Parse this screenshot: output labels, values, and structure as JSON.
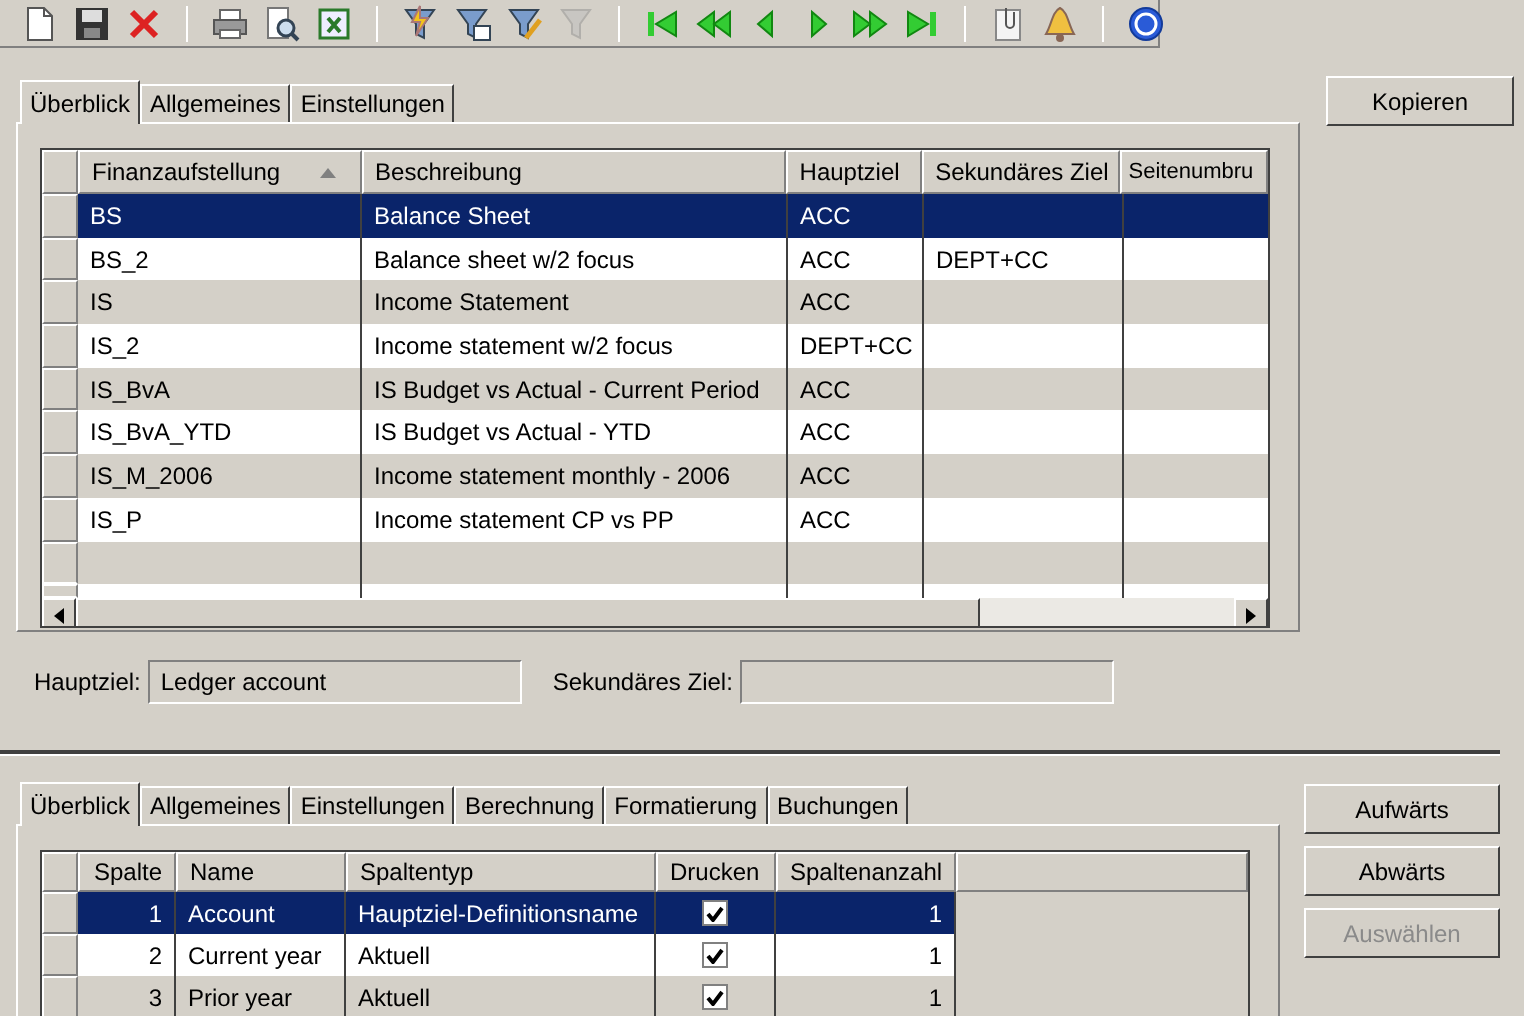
{
  "toolbar": [
    {
      "kind": "new",
      "disabled": false
    },
    {
      "kind": "save",
      "disabled": false
    },
    {
      "kind": "delete",
      "disabled": false
    },
    {
      "kind": "sep"
    },
    {
      "kind": "print",
      "disabled": false
    },
    {
      "kind": "preview",
      "disabled": false
    },
    {
      "kind": "excel",
      "disabled": false
    },
    {
      "kind": "sep"
    },
    {
      "kind": "filter-bolt",
      "disabled": false
    },
    {
      "kind": "filter-table",
      "disabled": false
    },
    {
      "kind": "filter-pencil",
      "disabled": false
    },
    {
      "kind": "filter-clear",
      "disabled": true
    },
    {
      "kind": "sep"
    },
    {
      "kind": "first",
      "disabled": false
    },
    {
      "kind": "prev-page",
      "disabled": false
    },
    {
      "kind": "prev",
      "disabled": false
    },
    {
      "kind": "next",
      "disabled": false
    },
    {
      "kind": "next-page",
      "disabled": false
    },
    {
      "kind": "last",
      "disabled": false
    },
    {
      "kind": "sep"
    },
    {
      "kind": "attach",
      "disabled": false
    },
    {
      "kind": "alert",
      "disabled": false
    },
    {
      "kind": "sep"
    },
    {
      "kind": "help",
      "disabled": false
    }
  ],
  "upper": {
    "tabs": [
      {
        "label": "Überblick",
        "selected": true
      },
      {
        "label": "Allgemeines",
        "selected": false
      },
      {
        "label": "Einstellungen",
        "selected": false
      }
    ],
    "table": {
      "columns": [
        {
          "label": "Finanzaufstellung",
          "sorted_ascending": true
        },
        {
          "label": "Beschreibung"
        },
        {
          "label": "Hauptziel"
        },
        {
          "label": "Sekundäres Ziel"
        },
        {
          "label": "Seitenumbru"
        }
      ],
      "rows": [
        {
          "cells": [
            "BS",
            "Balance Sheet",
            "ACC",
            "",
            ""
          ],
          "selected": true
        },
        {
          "cells": [
            "BS_2",
            "Balance sheet w/2 focus",
            "ACC",
            "DEPT+CC",
            ""
          ],
          "selected": false
        },
        {
          "cells": [
            "IS",
            "Income Statement",
            "ACC",
            "",
            ""
          ],
          "selected": false
        },
        {
          "cells": [
            "IS_2",
            "Income statement w/2 focus",
            "DEPT+CC",
            "",
            ""
          ],
          "selected": false
        },
        {
          "cells": [
            "IS_BvA",
            "IS Budget vs Actual - Current Period",
            "ACC",
            "",
            ""
          ],
          "selected": false
        },
        {
          "cells": [
            "IS_BvA_YTD",
            "IS Budget vs Actual - YTD",
            "ACC",
            "",
            ""
          ],
          "selected": false
        },
        {
          "cells": [
            "IS_M_2006",
            "Income statement monthly - 2006",
            "ACC",
            "",
            ""
          ],
          "selected": false
        },
        {
          "cells": [
            "IS_P",
            "Income statement CP vs PP",
            "ACC",
            "",
            ""
          ],
          "selected": false
        }
      ]
    },
    "fields": [
      {
        "label": "Hauptziel:",
        "value": "Ledger account"
      },
      {
        "label": "Sekundäres Ziel:"
      }
    ],
    "button": {
      "label": "Kopieren",
      "disabled": false
    }
  },
  "lower": {
    "tabs": [
      {
        "label": "Überblick",
        "selected": true
      },
      {
        "label": "Allgemeines",
        "selected": false
      },
      {
        "label": "Einstellungen",
        "selected": false
      },
      {
        "label": "Berechnung",
        "selected": false
      },
      {
        "label": "Formatierung",
        "selected": false
      },
      {
        "label": "Buchungen",
        "selected": false
      }
    ],
    "table": {
      "columns": [
        "Spalte",
        "Name",
        "Spaltentyp",
        "Drucken",
        "Spaltenanzahl"
      ],
      "rows": [
        {
          "spalte": "1",
          "name": "Account",
          "type": "Hauptziel-Definitionsname",
          "print": true,
          "count": "1",
          "selected": true
        },
        {
          "spalte": "2",
          "name": "Current year",
          "type": "Aktuell",
          "print": true,
          "count": "1",
          "selected": false
        },
        {
          "spalte": "3",
          "name": "Prior year",
          "type": "Aktuell",
          "print": true,
          "count": "1",
          "selected": false
        }
      ]
    },
    "buttons": [
      {
        "label": "Aufwärts",
        "disabled": false
      },
      {
        "label": "Abwärts",
        "disabled": false
      },
      {
        "label": "Auswählen",
        "disabled": true
      }
    ]
  }
}
